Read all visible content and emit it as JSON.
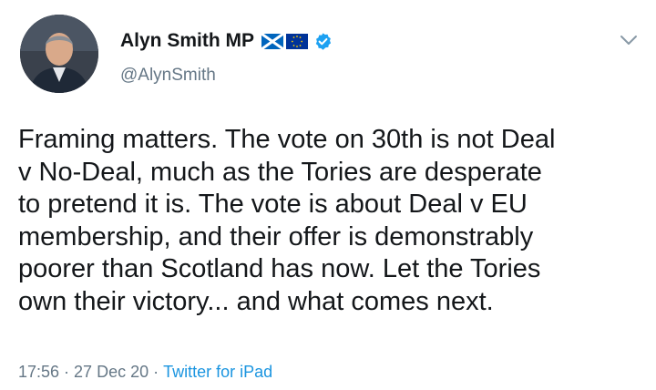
{
  "tweet": {
    "author": {
      "display_name": "Alyn Smith MP",
      "handle": "@AlynSmith",
      "verified": true,
      "flags": [
        "scotland-flag",
        "eu-flag"
      ]
    },
    "body_lines": [
      "Framing matters. The vote on 30th is not Deal",
      "v No-Deal, much as the Tories are desperate",
      "to pretend it is. The vote is about Deal v EU",
      "membership, and their offer is demonstrably",
      "poorer than Scotland has now. Let the Tories",
      "own their victory... and what comes next."
    ],
    "meta": {
      "time": "17:56",
      "separator": "·",
      "date": "27 Dec 20",
      "source": "Twitter for iPad"
    }
  },
  "colors": {
    "text": "#14171a",
    "secondary": "#657786",
    "link": "#1b95e0",
    "verified": "#1da1f2"
  },
  "icons": [
    "chevron-down-icon",
    "verified-badge-icon"
  ]
}
